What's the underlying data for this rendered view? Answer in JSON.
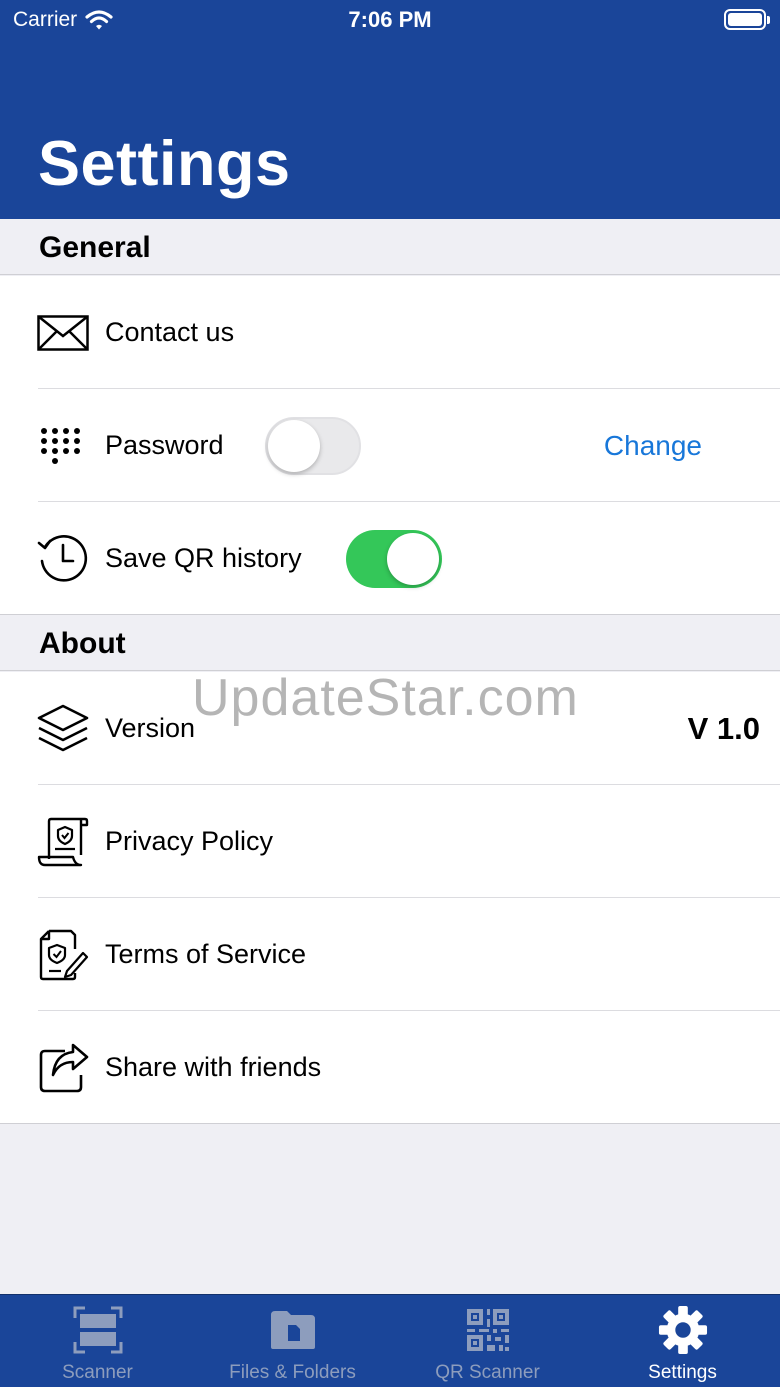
{
  "status_bar": {
    "carrier": "Carrier",
    "time": "7:06 PM"
  },
  "header": {
    "title": "Settings"
  },
  "sections": {
    "general": {
      "title": "General",
      "contact_label": "Contact us",
      "password_label": "Password",
      "password_enabled": false,
      "password_action": "Change",
      "save_qr_label": "Save QR history",
      "save_qr_enabled": true
    },
    "about": {
      "title": "About",
      "version_label": "Version",
      "version_value": "V 1.0",
      "privacy_label": "Privacy Policy",
      "terms_label": "Terms of Service",
      "share_label": "Share with friends"
    }
  },
  "watermark": "UpdateStar.com",
  "tabbar": {
    "tabs": [
      {
        "label": "Scanner",
        "icon": "scanner-icon",
        "active": false
      },
      {
        "label": "Files & Folders",
        "icon": "folder-icon",
        "active": false
      },
      {
        "label": "QR Scanner",
        "icon": "qr-code-icon",
        "active": false
      },
      {
        "label": "Settings",
        "icon": "gear-icon",
        "active": true
      }
    ]
  },
  "colors": {
    "brand": "#1a4599",
    "link": "#1877d9",
    "toggle_on": "#34c759",
    "tab_inactive": "#8d9dbd"
  }
}
